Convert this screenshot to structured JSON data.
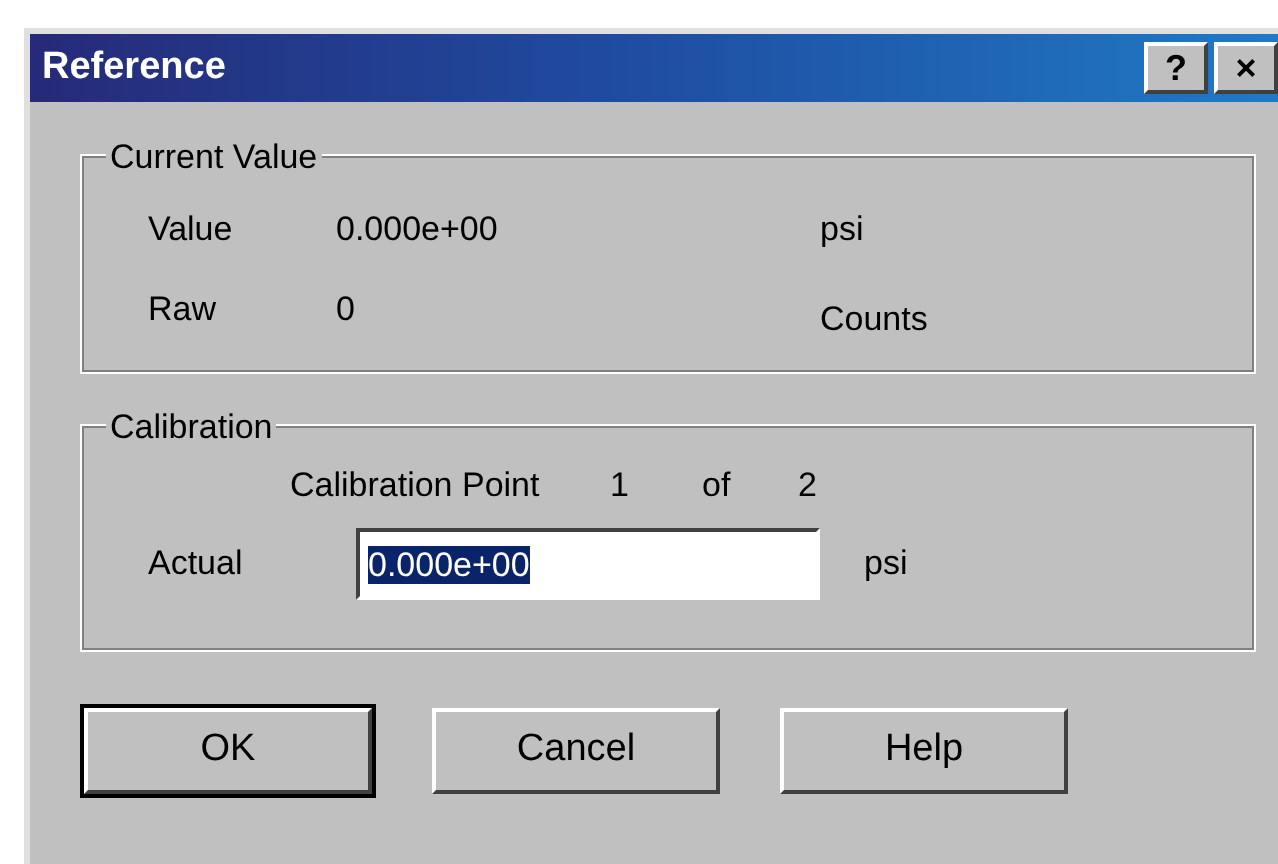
{
  "window": {
    "title": "Reference",
    "title_buttons": [
      "?",
      "×"
    ]
  },
  "current_value": {
    "title": "Current Value",
    "rows": [
      {
        "label": "Value",
        "value": "0.000e+00",
        "unit": "psi"
      },
      {
        "label": "Raw",
        "value": "0",
        "unit": "Counts"
      }
    ]
  },
  "calibration": {
    "title": "Calibration",
    "point_label": "Calibration Point",
    "point": "1",
    "of": "of",
    "total": "2",
    "actual_label": "Actual",
    "actual_value": "0.000e+00",
    "actual_selected": true,
    "actual_unit": "psi"
  },
  "buttons": [
    {
      "label": "OK",
      "default": true
    },
    {
      "label": "Cancel",
      "default": false
    },
    {
      "label": "Help",
      "default": false
    }
  ]
}
